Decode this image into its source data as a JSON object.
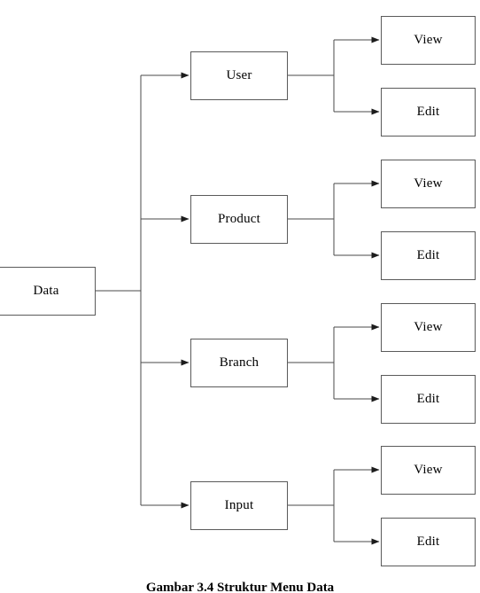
{
  "figure": {
    "caption": "Gambar 3.4 Struktur Menu Data",
    "type": "tree-diagram",
    "root": {
      "label": "Data"
    },
    "branches": [
      {
        "label": "User",
        "children": [
          {
            "label": "View"
          },
          {
            "label": "Edit"
          }
        ]
      },
      {
        "label": "Product",
        "children": [
          {
            "label": "View"
          },
          {
            "label": "Edit"
          }
        ]
      },
      {
        "label": "Branch",
        "children": [
          {
            "label": "View"
          },
          {
            "label": "Edit"
          }
        ]
      },
      {
        "label": "Input",
        "children": [
          {
            "label": "View"
          },
          {
            "label": "Edit"
          }
        ]
      }
    ],
    "colors": {
      "background": "#ffffff",
      "box_border": "#5a5a5a",
      "connector": "#4a4a4a",
      "text": "#000000"
    }
  }
}
